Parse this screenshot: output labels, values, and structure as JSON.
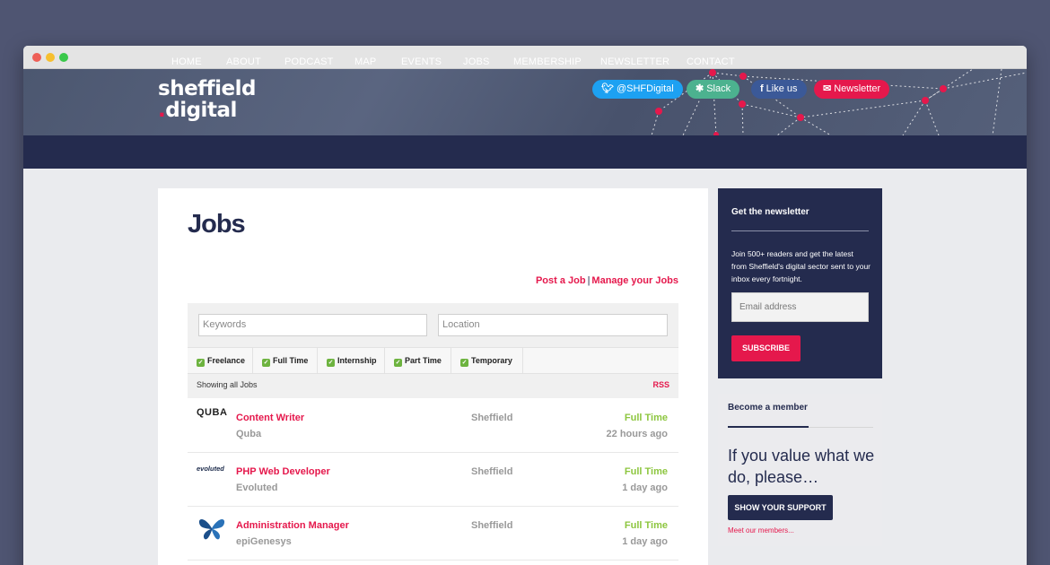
{
  "site": {
    "logo_line1": "sheffield",
    "logo_line2_dot": ".",
    "logo_line2": "digital"
  },
  "social": {
    "twitter": "@SHFDigital",
    "slack": "Slack",
    "facebook": "Like us",
    "newsletter": "Newsletter"
  },
  "nav": [
    "HOME",
    "ABOUT",
    "PODCAST",
    "MAP",
    "EVENTS",
    "JOBS",
    "MEMBERSHIP",
    "NEWSLETTER",
    "CONTACT"
  ],
  "page": {
    "title": "Jobs",
    "post_job": "Post a Job",
    "separator": "|",
    "manage_jobs": "Manage your Jobs"
  },
  "filters": {
    "keywords_placeholder": "Keywords",
    "location_placeholder": "Location",
    "types": [
      "Freelance",
      "Full Time",
      "Internship",
      "Part Time",
      "Temporary"
    ],
    "showing": "Showing all Jobs",
    "rss": "RSS"
  },
  "jobs": [
    {
      "title": "Content Writer",
      "company": "Quba",
      "location": "Sheffield",
      "type": "Full Time",
      "posted": "22 hours ago",
      "logo": "QUBA"
    },
    {
      "title": "PHP Web Developer",
      "company": "Evoluted",
      "location": "Sheffield",
      "type": "Full Time",
      "posted": "1 day ago",
      "logo": "evoluted"
    },
    {
      "title": "Administration Manager",
      "company": "epiGenesys",
      "location": "Sheffield",
      "type": "Full Time",
      "posted": "1 day ago",
      "logo": "butterfly-icon"
    }
  ],
  "newsletter": {
    "heading": "Get the newsletter",
    "text": "Join 500+ readers and get the latest from Sheffield's digital sector sent to your inbox every fortnight.",
    "email_placeholder": "Email address",
    "subscribe": "SUBSCRIBE"
  },
  "member": {
    "heading": "Become a member",
    "pitch": "If you value what we do, please…",
    "button": "SHOW YOUR SUPPORT",
    "meet": "Meet our members..."
  },
  "colors": {
    "navy": "#242b4e",
    "brand_pink": "#e5184c",
    "green": "#8dc63f"
  }
}
